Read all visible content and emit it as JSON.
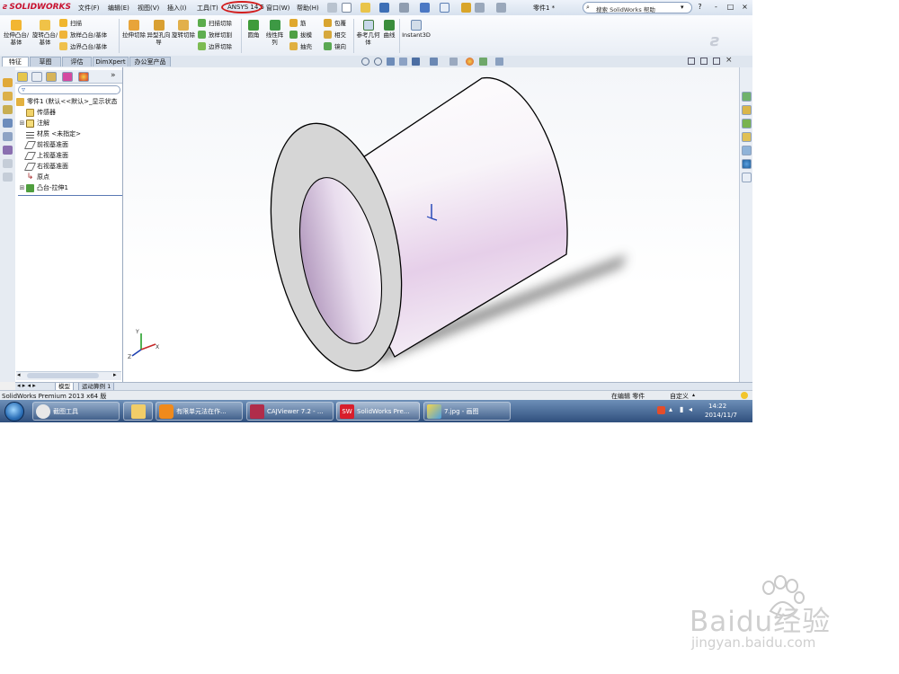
{
  "menubar": {
    "logo_text": "SOLIDWORKS",
    "menus": [
      "文件(F)",
      "编辑(E)",
      "视图(V)",
      "插入(I)",
      "工具(T)",
      "ANSYS 14.5",
      "窗口(W)",
      "帮助(H)"
    ],
    "document_title": "零件1 *",
    "search_placeholder": "搜索 SolidWorks 帮助",
    "window_buttons": [
      "?",
      "-",
      "□",
      "×"
    ]
  },
  "toolbar": {
    "big_tools": [
      "拉伸凸台/基体",
      "旋转凸台/基体",
      "拉伸切除",
      "异型孔向导",
      "旋转切除",
      "圆角",
      "线性阵列",
      "参考几何体",
      "曲线",
      "Instant3D"
    ],
    "sweep_group": [
      "扫描",
      "放样凸台/基体",
      "边界凸台/基体"
    ],
    "cut_group": [
      "扫描切除",
      "放样切割",
      "边界切除"
    ],
    "feature_group": [
      "筋",
      "拔模",
      "抽壳"
    ],
    "misc_group": [
      "包覆",
      "相交",
      "镜向"
    ]
  },
  "tabs": [
    "特征",
    "草图",
    "评估",
    "DimXpert",
    "办公室产品"
  ],
  "feature_tree": {
    "root": "零件1 (默认<<默认>_显示状态",
    "items": [
      "传感器",
      "注解",
      "材质 <未指定>",
      "前视基准面",
      "上视基准面",
      "右视基准面",
      "原点",
      "凸台-拉伸1"
    ]
  },
  "model_tabs": [
    "模型",
    "运动算例 1"
  ],
  "statusbar": {
    "left": "SolidWorks Premium 2013 x64 版",
    "mode": "在编辑 零件",
    "custom": "自定义"
  },
  "taskbar": {
    "items": [
      "截图工具",
      "",
      "有限单元法在作...",
      "CAJViewer 7.2 - ...",
      "SolidWorks Pre...",
      "7.jpg - 画图"
    ],
    "time": "14:22",
    "date": "2014/11/7"
  },
  "watermark": {
    "brand": "Baidu经验",
    "url": "jingyan.baidu.com"
  },
  "colors": {
    "ansys_circle": "#d21d1d",
    "cylinder_tint": "#e6cfe9",
    "taskbar": "#2f4f7d"
  }
}
